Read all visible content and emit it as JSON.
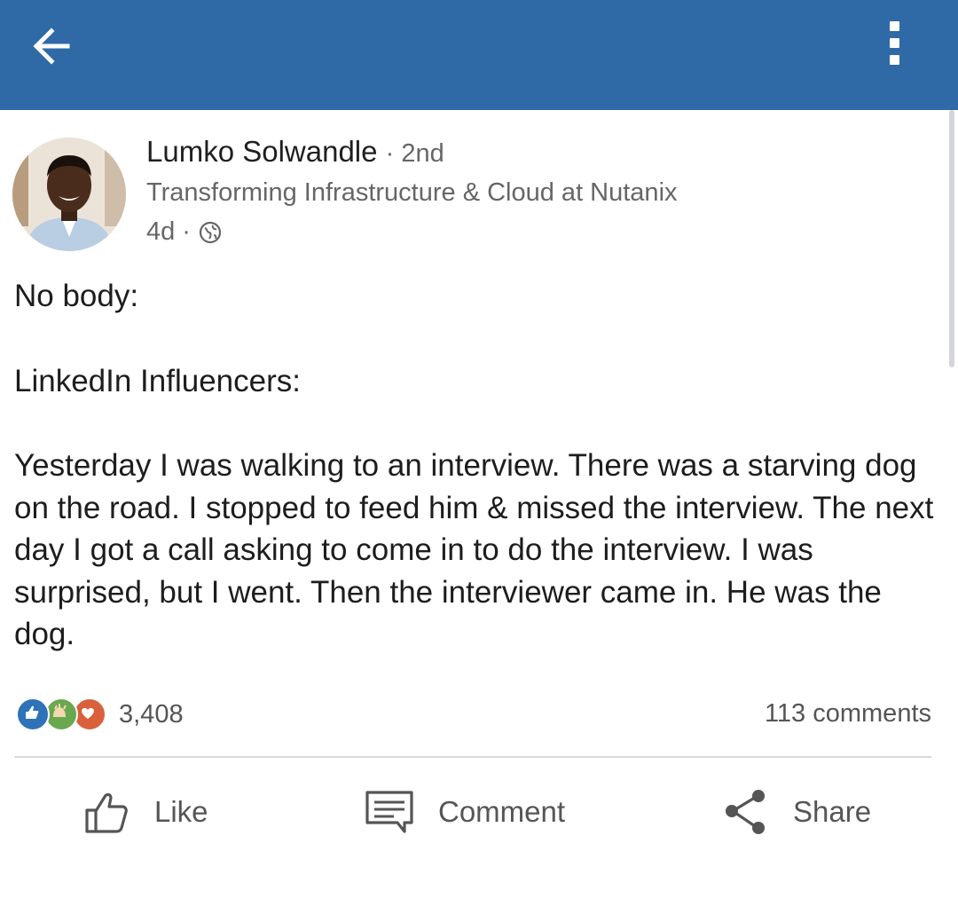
{
  "colors": {
    "header": "#2f6aa7",
    "like_reaction": "#2e72b8",
    "celebrate_reaction": "#6aa84f",
    "love_reaction": "#d9603b"
  },
  "header": {
    "back_icon": "arrow-left-icon",
    "menu_icon": "more-vertical-icon"
  },
  "post": {
    "author": {
      "name": "Lumko Solwandle",
      "degree": "· 2nd",
      "headline": "Transforming Infrastructure & Cloud at Nutanix"
    },
    "age": "4d",
    "separator": "·",
    "visibility_icon": "globe-icon",
    "body": [
      "No body:",
      "LinkedIn Influencers:",
      "Yesterday I was walking to an interview. There was a starving dog on the road. I stopped to feed him & missed the interview. The next day I got a call asking to come in to do the interview. I was surprised, but I went. Then the interviewer came in. He was the dog."
    ]
  },
  "social": {
    "reaction_icons": [
      "like-reaction-icon",
      "celebrate-reaction-icon",
      "love-reaction-icon"
    ],
    "reaction_count": "3,408",
    "comments": "113 comments"
  },
  "actions": {
    "like": "Like",
    "comment": "Comment",
    "share": "Share"
  }
}
